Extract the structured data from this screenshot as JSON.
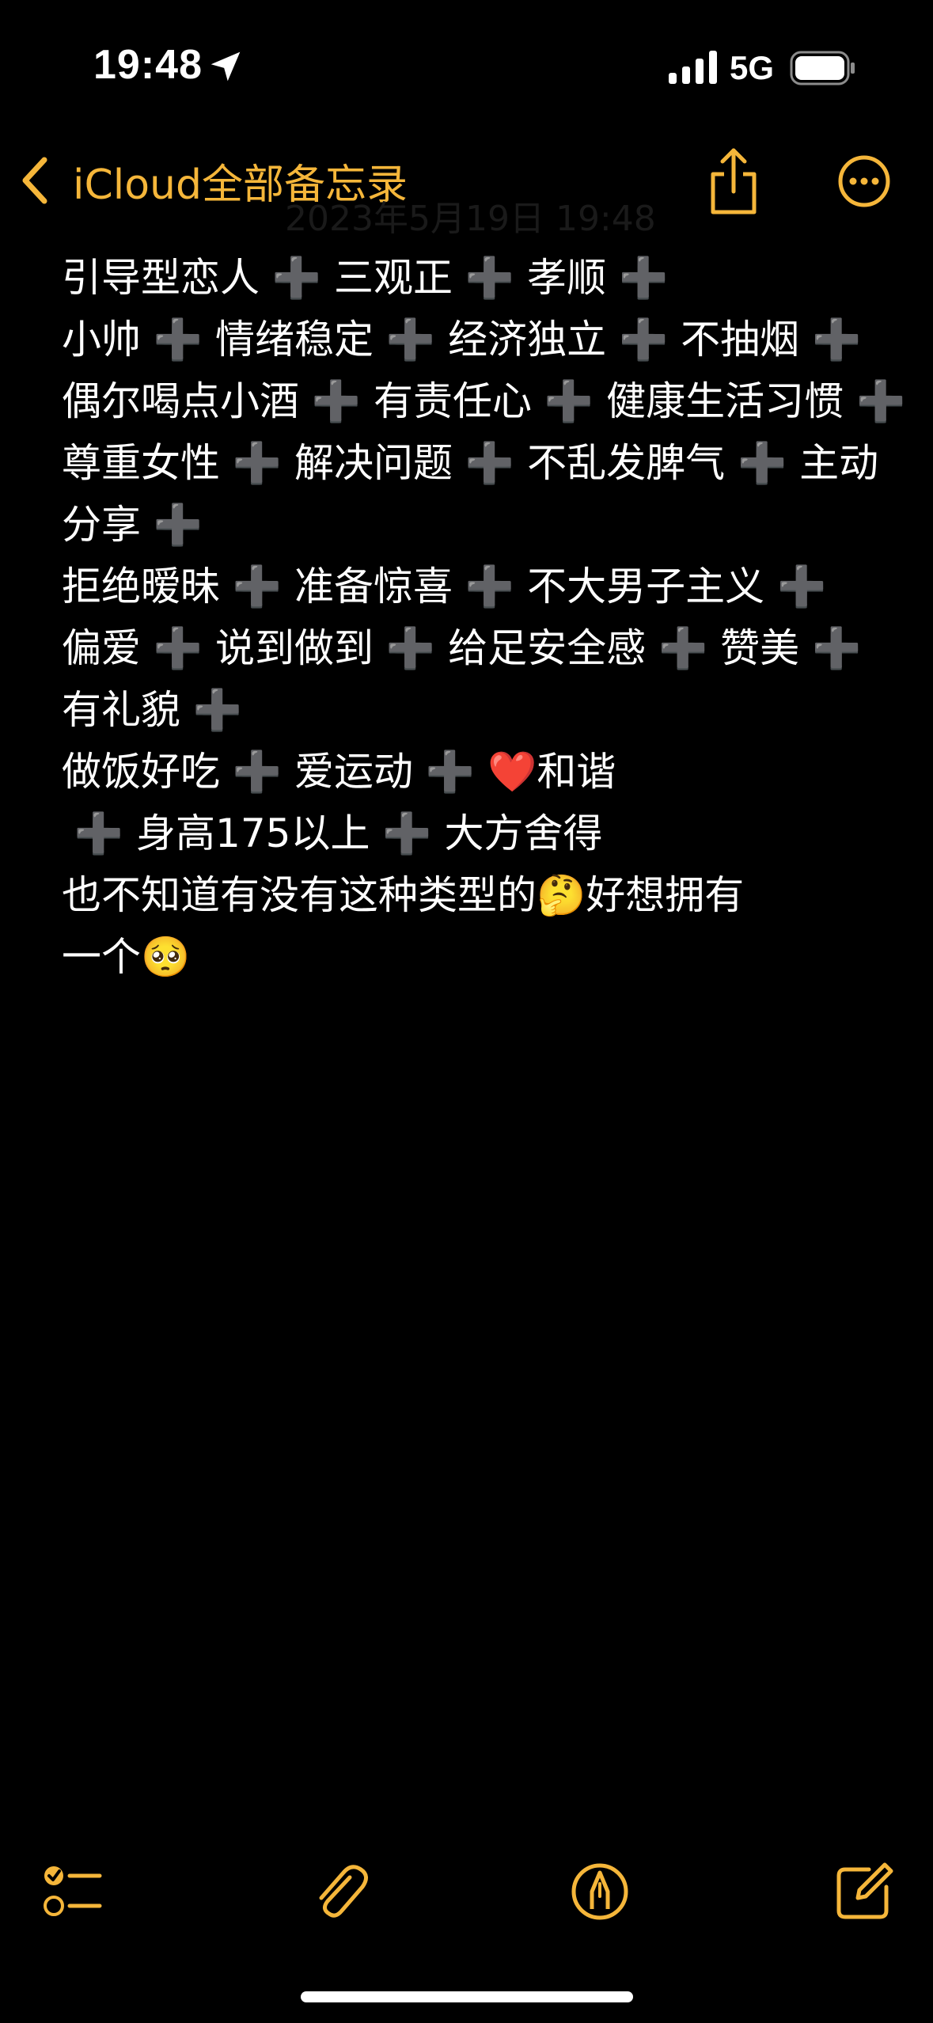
{
  "status_bar": {
    "time": "19:48",
    "network": "5G"
  },
  "nav": {
    "back_label": "iCloud全部备忘录",
    "ghost_date": "2023年5月19日 19:48"
  },
  "note": {
    "lines": [
      "引导型恋人 ➕ 三观正 ➕ 孝顺 ➕",
      "小帅 ➕ 情绪稳定 ➕ 经济独立 ➕ 不抽烟 ➕",
      "偶尔喝点小酒 ➕ 有责任心 ➕ 健康生活习惯 ➕",
      "尊重女性 ➕ 解决问题 ➕ 不乱发脾气 ➕ 主动",
      "分享 ➕",
      "拒绝暧昧 ➕ 准备惊喜 ➕ 不大男子主义 ➕",
      "偏爱 ➕ 说到做到 ➕ 给足安全感 ➕ 赞美 ➕",
      "有礼貌 ➕",
      "做饭好吃 ➕ 爱运动 ➕ ❤️和谐",
      " ➕ 身高175以上 ➕ 大方舍得",
      "也不知道有没有这种类型的🤔好想拥有",
      "一个🥺"
    ]
  },
  "colors": {
    "accent": "#f5b63a",
    "background": "#000000",
    "text": "#ffffff"
  },
  "icons": {
    "location": "location-arrow-icon",
    "signal": "cellular-signal-icon",
    "battery": "battery-icon",
    "back": "chevron-left-icon",
    "share": "share-icon",
    "more": "ellipsis-circle-icon",
    "checklist": "checklist-icon",
    "attach": "paperclip-icon",
    "markup": "markup-pen-icon",
    "compose": "compose-icon"
  }
}
